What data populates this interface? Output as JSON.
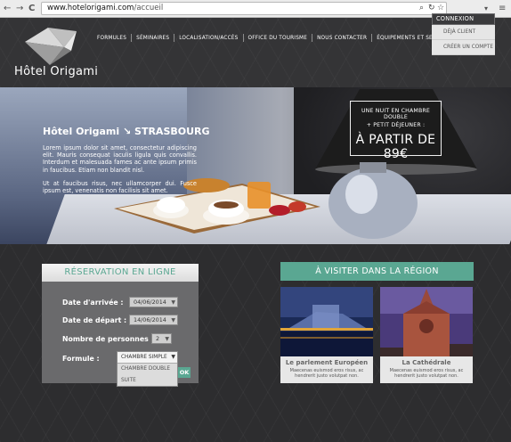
{
  "browser": {
    "back": "←",
    "forward": "→",
    "reload": "C",
    "url_host": "www.hotelorigami.com",
    "url_path": "/accueil",
    "menu_icon": "≡",
    "dropdown_icon": "▾"
  },
  "header": {
    "brand": "Hôtel Origami",
    "menu": [
      "Formules",
      "Séminaires",
      "Localisation/Accès",
      "Office du tourisme",
      "Nous contacter",
      "Équipements et services"
    ],
    "connexion": {
      "label": "Connexion",
      "items": [
        "Déjà client",
        "Créer un compte"
      ]
    }
  },
  "hero": {
    "title": "Hôtel Origami ↘ STRASBOURG",
    "paragraphs": [
      "Lorem ipsum dolor sit amet, consectetur adipiscing elit. Mauris consequat iaculis ligula quis convallis. Interdum et malesuada fames ac ante ipsum primis in faucibus. Etiam non blandit nisl.",
      "Ut at faucibus risus, nec ullamcorper dui. Fusce ipsum est, venenatis non facilisis sit amet."
    ],
    "offer": {
      "line1": "Une nuit en chambre double",
      "line2": "+ petit déjeuner :",
      "line3": "À partir de 89€"
    }
  },
  "reservation": {
    "title": "Réservation en ligne",
    "arrival_label": "Date d'arrivée :",
    "arrival_value": "04/06/2014",
    "departure_label": "Date de départ :",
    "departure_value": "14/06/2014",
    "persons_label": "Nombre de personnes :",
    "persons_value": "2",
    "formula_label": "Formule :",
    "formula_value": "Chambre simple",
    "formula_options": [
      "Chambre double",
      "Suite"
    ],
    "submit_label": "OK"
  },
  "visit": {
    "title": "À visiter dans la région",
    "cards": [
      {
        "name": "Le parlement Européen",
        "desc": "Maecenas euismod eros risus, ac hendrerit justo volutpat non."
      },
      {
        "name": "La Cathédrale",
        "desc": "Maecenas euismod eros risus, ac hendrerit justo volutpat non."
      }
    ]
  },
  "colors": {
    "accent": "#5aa792",
    "header_bg": "#343436",
    "dropdown_bg": "#e6e6e6"
  }
}
